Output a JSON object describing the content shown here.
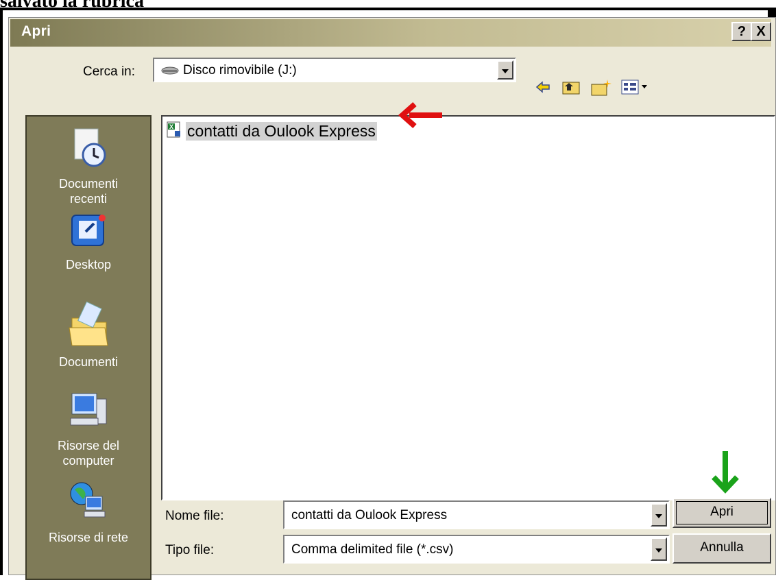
{
  "header_text": "salvato la rubrica",
  "dialog": {
    "title": "Apri",
    "help_button": "?",
    "close_button": "X"
  },
  "look_in": {
    "label": "Cerca in:",
    "value": "Disco rimovibile (J:)",
    "toolbar_icons": [
      "back-icon",
      "up-folder-icon",
      "new-folder-icon",
      "view-menu-icon"
    ]
  },
  "places": [
    {
      "label_line1": "Documenti",
      "label_line2": "recenti",
      "icon": "recent-documents-icon"
    },
    {
      "label_line1": "Desktop",
      "label_line2": "",
      "icon": "desktop-icon"
    },
    {
      "label_line1": "Documenti",
      "label_line2": "",
      "icon": "my-documents-icon"
    },
    {
      "label_line1": "Risorse del",
      "label_line2": "computer",
      "icon": "my-computer-icon"
    },
    {
      "label_line1": "Risorse di rete",
      "label_line2": "",
      "icon": "network-icon"
    }
  ],
  "files": [
    {
      "name": "contatti da Oulook Express",
      "icon": "excel-csv-file-icon"
    }
  ],
  "filename": {
    "label": "Nome file:",
    "value": "contatti da Oulook Express"
  },
  "filetype": {
    "label": "Tipo file:",
    "value": "Comma delimited file (*.csv)"
  },
  "buttons": {
    "open": "Apri",
    "cancel": "Annulla"
  },
  "annotation_colors": {
    "red_arrow": "#e01010",
    "green_arrow": "#1aa31a"
  }
}
